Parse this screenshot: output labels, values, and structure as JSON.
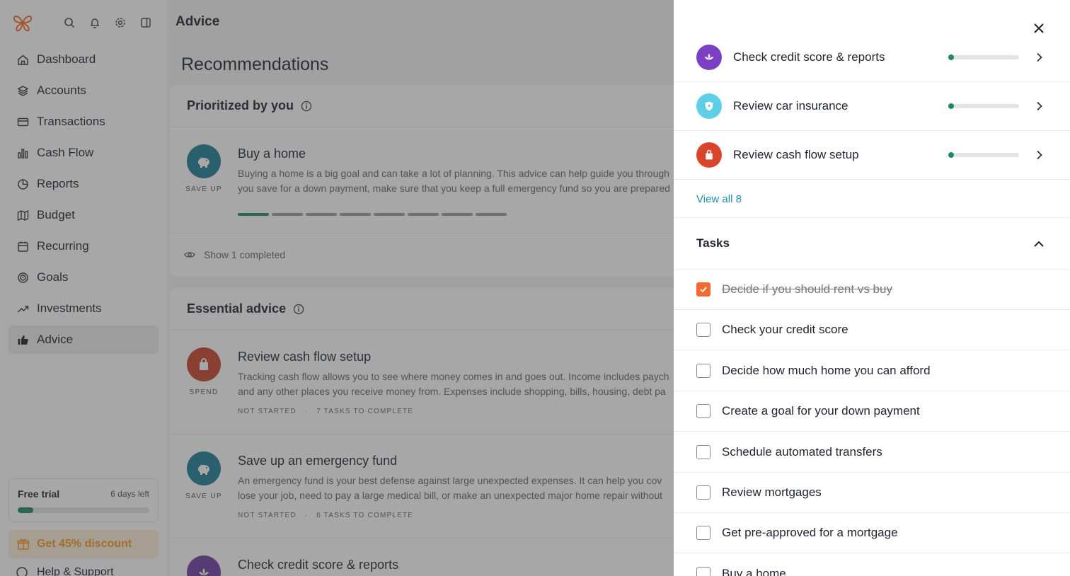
{
  "sidebar": {
    "nav": [
      {
        "label": "Dashboard",
        "icon": "home-icon"
      },
      {
        "label": "Accounts",
        "icon": "layers-icon"
      },
      {
        "label": "Transactions",
        "icon": "card-icon"
      },
      {
        "label": "Cash Flow",
        "icon": "bar-chart-icon"
      },
      {
        "label": "Reports",
        "icon": "pie-chart-icon"
      },
      {
        "label": "Budget",
        "icon": "map-icon"
      },
      {
        "label": "Recurring",
        "icon": "calendar-icon"
      },
      {
        "label": "Goals",
        "icon": "target-icon"
      },
      {
        "label": "Investments",
        "icon": "trending-up-icon"
      },
      {
        "label": "Advice",
        "icon": "thumbs-up-icon"
      }
    ],
    "active": "Advice",
    "trial": {
      "title": "Free trial",
      "days_left": "6 days left",
      "progress": 0.12
    },
    "discount_label": "Get 45% discount",
    "help_label": "Help & Support"
  },
  "header": {
    "title": "Advice"
  },
  "main": {
    "title": "Recommendations",
    "prioritized": {
      "title": "Prioritized by you",
      "item": {
        "title": "Buy a home",
        "category": "SAVE UP",
        "desc_line1": "Buying a home is a big goal and can take a lot of planning. This advice can help guide you through",
        "desc_line2": "you save for a down payment, make sure that you keep a full emergency fund so you are prepared",
        "segments_total": 8,
        "segments_done": 1
      },
      "show_completed": "Show 1 completed"
    },
    "essential": {
      "title": "Essential advice",
      "items": [
        {
          "title": "Review cash flow setup",
          "category": "SPEND",
          "desc_line1": "Tracking cash flow allows you to see where money comes in and goes out. Income includes paych",
          "desc_line2": "and any other places you receive money from. Expenses include shopping, bills, housing, debt pa",
          "status": "NOT STARTED",
          "tasks": "7 TASKS TO COMPLETE"
        },
        {
          "title": "Save up an emergency fund",
          "category": "SAVE UP",
          "desc_line1": "An emergency fund is your best defense against large unexpected expenses. It can help you cov",
          "desc_line2": "lose your job, need to pay a large medical bill, or make an unexpected major home repair without",
          "status": "NOT STARTED",
          "tasks": "6 TASKS TO COMPLETE"
        },
        {
          "title": "Check credit score & reports",
          "category": "",
          "desc_line1": "",
          "desc_line2": "",
          "status": "",
          "tasks": ""
        }
      ]
    }
  },
  "panel": {
    "related": [
      {
        "label": "Check credit score & reports",
        "color": "#7b3fc4",
        "progress": 0.04
      },
      {
        "label": "Review car insurance",
        "color": "#5ecfe6",
        "progress": 0.04
      },
      {
        "label": "Review cash flow setup",
        "color": "#d9452b",
        "progress": 0.04
      }
    ],
    "view_all": "View all 8",
    "tasks_title": "Tasks",
    "tasks": [
      {
        "label": "Decide if you should rent vs buy",
        "done": true
      },
      {
        "label": "Check your credit score",
        "done": false
      },
      {
        "label": "Decide how much home you can afford",
        "done": false
      },
      {
        "label": "Create a goal for your down payment",
        "done": false
      },
      {
        "label": "Schedule automated transfers",
        "done": false
      },
      {
        "label": "Review mortgages",
        "done": false
      },
      {
        "label": "Get pre-approved for a mortgage",
        "done": false
      },
      {
        "label": "Buy a home",
        "done": false
      }
    ]
  },
  "colors": {
    "green": "#1f8a5b",
    "teal": "#1c7f95",
    "orange": "#f26a2d",
    "red": "#c8432b",
    "purple": "#6b3fa0",
    "link": "#1f8fa8"
  }
}
